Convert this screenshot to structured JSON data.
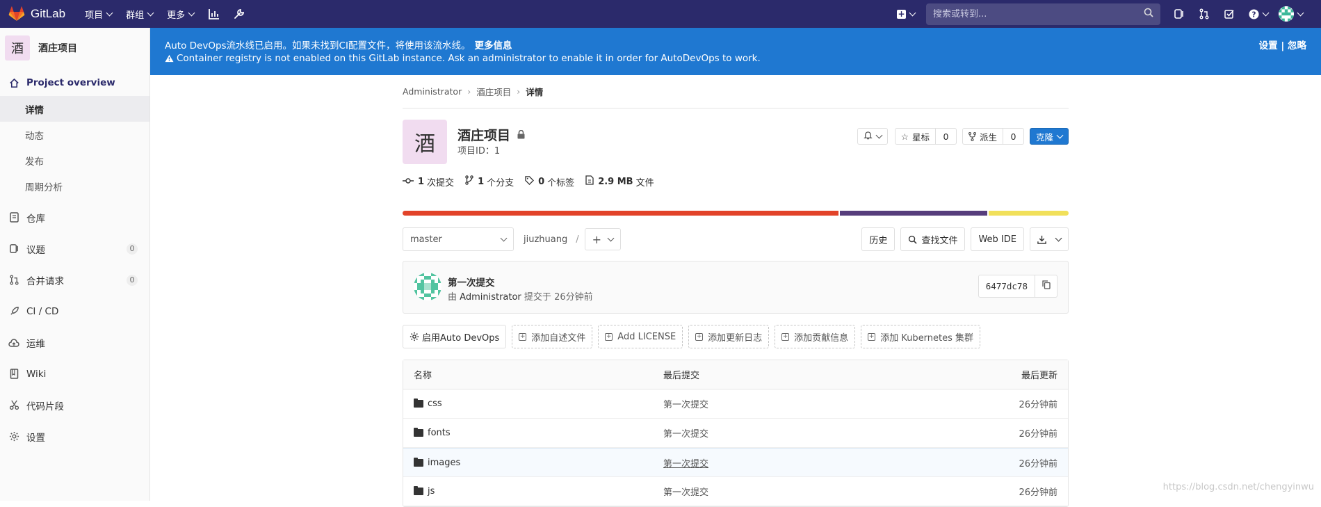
{
  "navbar": {
    "brand": "GitLab",
    "menu": [
      "项目",
      "群组",
      "更多"
    ],
    "search_placeholder": "搜索或转到..."
  },
  "sidebar": {
    "project_initial": "酒",
    "project_name": "酒庄项目",
    "overview": "Project overview",
    "sub": [
      "详情",
      "动态",
      "发布",
      "周期分析"
    ],
    "items": [
      {
        "label": "仓库",
        "icon": "document-icon"
      },
      {
        "label": "议题",
        "icon": "issues-icon",
        "badge": "0"
      },
      {
        "label": "合并请求",
        "icon": "merge-request-icon",
        "badge": "0"
      },
      {
        "label": "CI / CD",
        "icon": "rocket-icon"
      },
      {
        "label": "运维",
        "icon": "cloud-icon"
      },
      {
        "label": "Wiki",
        "icon": "book-icon"
      },
      {
        "label": "代码片段",
        "icon": "scissors-icon"
      },
      {
        "label": "设置",
        "icon": "gear-icon"
      }
    ]
  },
  "banner": {
    "line1": "Auto DevOps流水线已启用。如果未找到CI配置文件，将使用该流水线。",
    "more": "更多信息",
    "line2": "Container registry is not enabled on this GitLab instance. Ask an administrator to enable it in order for AutoDevOps to work.",
    "actions": "设置 | 忽略"
  },
  "breadcrumb": [
    "Administrator",
    "酒庄项目",
    "详情"
  ],
  "project": {
    "initial": "酒",
    "title": "酒庄项目",
    "id_text": "项目ID：1",
    "star_label": "星标",
    "star_count": "0",
    "fork_label": "派生",
    "fork_count": "0",
    "clone_label": "克隆"
  },
  "stats": [
    {
      "num": "1",
      "label": "次提交",
      "icon": "commit-icon"
    },
    {
      "num": "1",
      "label": "个分支",
      "icon": "branch-icon"
    },
    {
      "num": "0",
      "label": "个标签",
      "icon": "tag-icon"
    },
    {
      "num": "2.9 MB",
      "label": "文件",
      "icon": "file-icon"
    }
  ],
  "language_bar": [
    {
      "color": "#e24329",
      "fraction": 0.657
    },
    {
      "color": "#563d7c",
      "fraction": 0.222
    },
    {
      "color": "#f1e05a",
      "fraction": 0.121
    }
  ],
  "toolbar": {
    "branch": "master",
    "path": "jiuzhuang",
    "slash": "/",
    "history": "历史",
    "find_file": "查找文件",
    "web_ide": "Web IDE"
  },
  "commit": {
    "title": "第一次提交",
    "by": "由",
    "author": "Administrator",
    "submitted": "提交于",
    "when": "26分钟前",
    "sha": "6477dc78"
  },
  "quick_actions": [
    "启用Auto DevOps",
    "添加自述文件",
    "Add LICENSE",
    "添加更新日志",
    "添加贡献信息",
    "添加 Kubernetes 集群"
  ],
  "tree": {
    "headers": [
      "名称",
      "最后提交",
      "最后更新"
    ],
    "rows": [
      {
        "name": "css",
        "commit": "第一次提交",
        "updated": "26分钟前"
      },
      {
        "name": "fonts",
        "commit": "第一次提交",
        "updated": "26分钟前"
      },
      {
        "name": "images",
        "commit": "第一次提交",
        "updated": "26分钟前"
      },
      {
        "name": "js",
        "commit": "第一次提交",
        "updated": "26分钟前"
      }
    ]
  },
  "watermark": "https://blog.csdn.net/chengyinwu"
}
